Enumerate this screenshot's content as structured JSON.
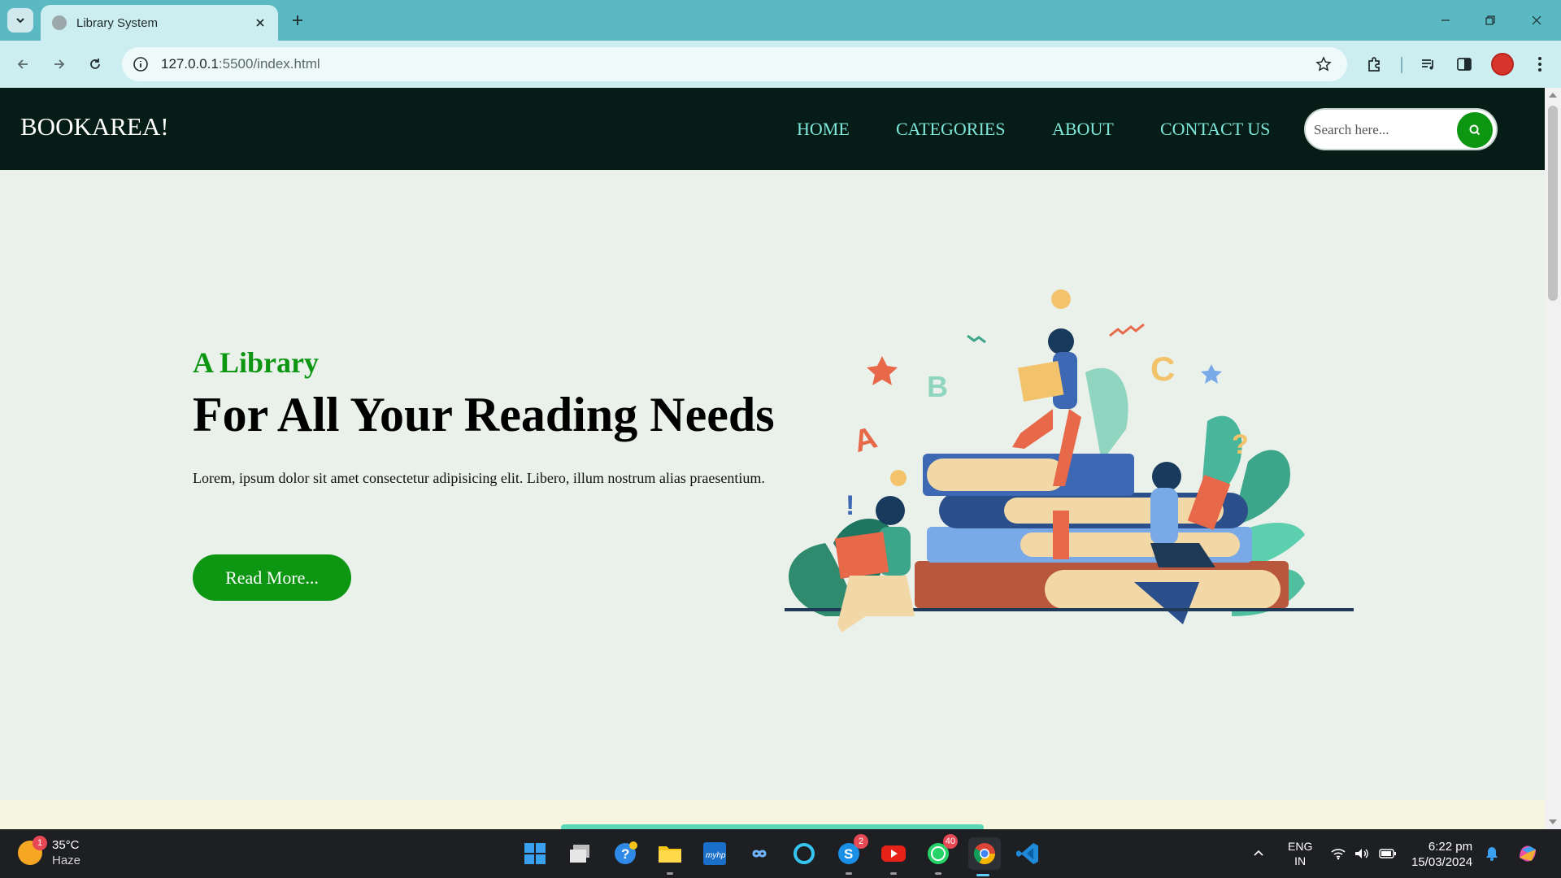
{
  "browser": {
    "tab_title": "Library System",
    "url_host": "127.0.0.1",
    "url_path": ":5500/index.html"
  },
  "site": {
    "logo": "BOOKAREA!",
    "nav": [
      "HOME",
      "CATEGORIES",
      "ABOUT",
      "CONTACT US"
    ],
    "search_placeholder": "Search here...",
    "hero": {
      "kicker": "A Library",
      "title": "For All Your Reading Needs",
      "text": "Lorem, ipsum dolor sit amet consectetur adipisicing elit. Libero, illum nostrum alias praesentium.",
      "button": "Read More..."
    },
    "colors": {
      "header_bg": "#061c16",
      "accent_green": "#0c9611",
      "nav_link": "#7ee8dc",
      "page_bg": "#e9f1ea"
    }
  },
  "taskbar": {
    "weather_temp": "35°C",
    "weather_cond": "Haze",
    "weather_badge": "1",
    "apps": [
      "windows-start",
      "task-view",
      "help",
      "file-explorer",
      "myhp",
      "meta-infinity",
      "cortana-circle",
      "skype",
      "youtube",
      "whatsapp",
      "chrome",
      "vscode"
    ],
    "skype_badge": "2",
    "whatsapp_badge": "40",
    "lang_1": "ENG",
    "lang_2": "IN",
    "time": "6:22 pm",
    "date": "15/03/2024"
  }
}
